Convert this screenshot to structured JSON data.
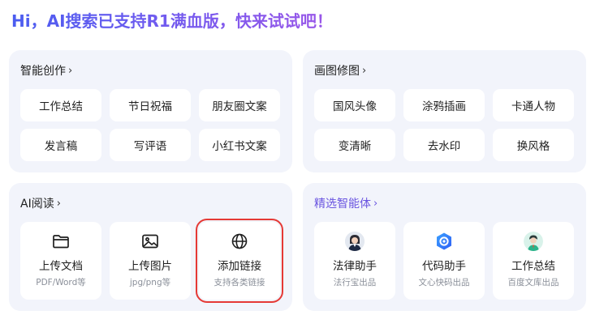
{
  "headline": "Hi，AI搜索已支持R1满血版，快来试试吧！",
  "sections": {
    "creation": {
      "title": "智能创作",
      "chips": [
        "工作总结",
        "节日祝福",
        "朋友圈文案",
        "发言稿",
        "写评语",
        "小红书文案"
      ]
    },
    "image_edit": {
      "title": "画图修图",
      "chips": [
        "国风头像",
        "涂鸦插画",
        "卡通人物",
        "变清晰",
        "去水印",
        "换风格"
      ]
    },
    "reading": {
      "title": "AI阅读",
      "tiles": [
        {
          "label": "上传文档",
          "sub": "PDF/Word等",
          "icon": "folder-icon"
        },
        {
          "label": "上传图片",
          "sub": "jpg/png等",
          "icon": "image-icon"
        },
        {
          "label": "添加链接",
          "sub": "支持各类链接",
          "icon": "globe-icon"
        }
      ]
    },
    "agents": {
      "title": "精选智能体",
      "tiles": [
        {
          "label": "法律助手",
          "sub": "法行宝出品",
          "icon": "lawyer-avatar-icon"
        },
        {
          "label": "代码助手",
          "sub": "文心快码出品",
          "icon": "code-assistant-icon"
        },
        {
          "label": "工作总结",
          "sub": "百度文库出品",
          "icon": "office-avatar-icon"
        }
      ]
    }
  },
  "chevron": "›",
  "colors": {
    "card_bg": "#f2f4fb",
    "accent": "#6a55e0",
    "selected_outline": "#e53935"
  }
}
